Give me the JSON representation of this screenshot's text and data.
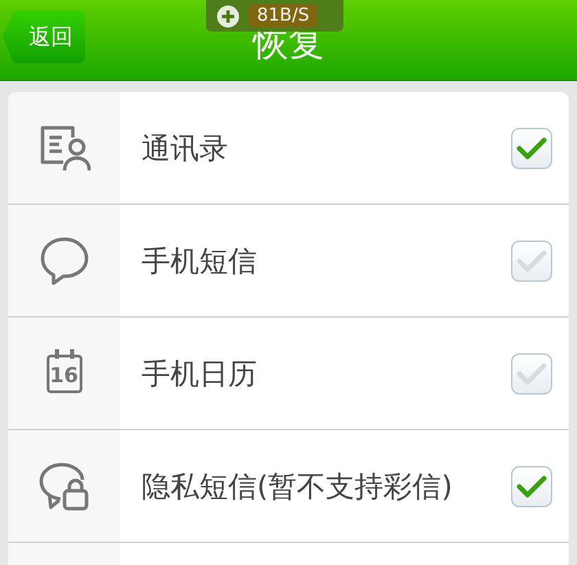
{
  "header": {
    "back": "返回",
    "title": "恢复",
    "speed": "81B/S"
  },
  "items": [
    {
      "kind": "contacts",
      "label": "通讯录",
      "checked": true
    },
    {
      "kind": "sms",
      "label": "手机短信",
      "checked": false
    },
    {
      "kind": "calendar",
      "label": "手机日历",
      "day": "16",
      "checked": false
    },
    {
      "kind": "private",
      "label": "隐私短信(暂不支持彩信)",
      "checked": true
    }
  ]
}
